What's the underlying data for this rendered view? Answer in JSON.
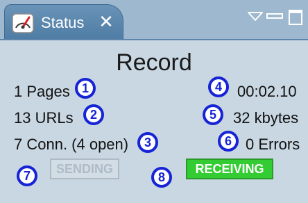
{
  "window": {
    "tab_title": "Status",
    "tab_icon": "speedometer-icon",
    "close_icon": "close-icon",
    "view_menu_icon": "view-menu-icon",
    "minimize_icon": "minimize-icon",
    "maximize_icon": "maximize-icon"
  },
  "status": {
    "title": "Record",
    "pages": "1 Pages",
    "urls": "13 URLs",
    "connections": "7 Conn. (4 open)",
    "elapsed": "00:02.10",
    "size": "32 kbytes",
    "errors": "0 Errors"
  },
  "indicators": {
    "sending": "SENDING",
    "receiving": "RECEIVING"
  },
  "badges": [
    "1",
    "2",
    "3",
    "4",
    "5",
    "6",
    "7",
    "8"
  ],
  "colors": {
    "badge": "#1624d6",
    "receiving_active": "#33cc33",
    "sending_inactive": "#aebbc6",
    "tab": "#5a87ae"
  }
}
